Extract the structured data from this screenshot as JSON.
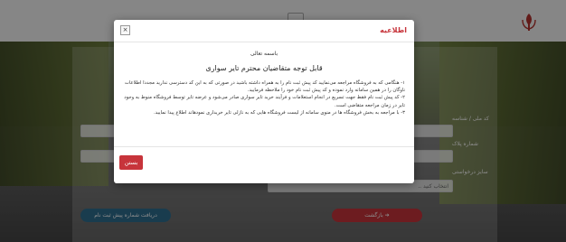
{
  "modal": {
    "title": "اطلاعیه",
    "close_symbol": "×",
    "bismillah": "باسمه تعالی",
    "headline": "قابل توجه متقاضیان محترم تایر سواری",
    "paragraphs": [
      "۱- هنگامی که به فروشگاه مراجعه می‌نمایید کد پیش ثبت نام را به همراه داشته باشید در صورتی که به این کد دسترسی ندارید مجددا اطلاعات ناوگان را در همین سامانه وارد نموده و کد پیش ثبت نام خود را ملاحظه فرمایید.",
      "۲- کد پیش ثبت نام فقط جهت تسریع در انجام استعلامات و فرآیند خرید تایر سواری صادر می‌شود و عرضه تایر توسط فروشگاه منوط به وجود تایر در زمان مراجعه متقاضی است.",
      "۳- با مراجعه به بخش فروشگاه ها در منوی سامانه از لیست فروشگاه هایی که به نازلی تایر خریداری نمودهاند اطلاع پیدا نمایید."
    ],
    "close_button": "بستن"
  },
  "form": {
    "labels": [
      "کد ملی / شناسه",
      "شماره پلاک",
      "سایز درخواستی"
    ],
    "select_placeholder": "انتخاب کنید ..",
    "back_button": "➔ بازگشت",
    "submit_button": "دریافت شماره پیش ثبت نام"
  },
  "colors": {
    "accent": "#c7343b",
    "primary": "#2f6d8f"
  },
  "icons": {
    "logo": "emblem-icon",
    "close": "close-icon"
  }
}
